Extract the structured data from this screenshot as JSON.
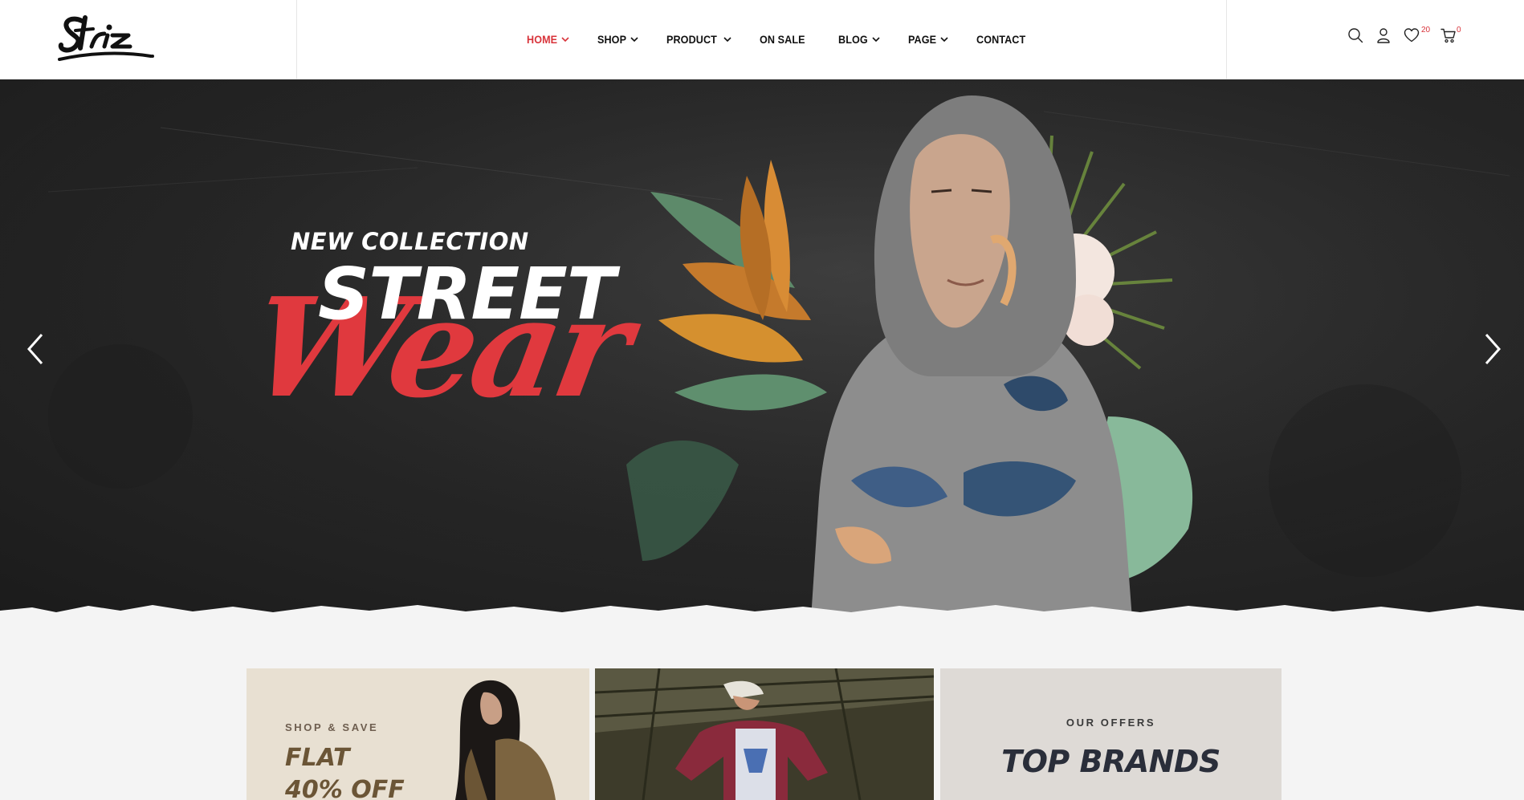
{
  "brand": {
    "logo_text": "Striz"
  },
  "nav": {
    "items": [
      {
        "label": "HOME",
        "has_dropdown": true,
        "active": true
      },
      {
        "label": "SHOP",
        "has_dropdown": true,
        "active": false
      },
      {
        "label": "PRODUCT",
        "has_dropdown": true,
        "active": false
      },
      {
        "label": "ON SALE",
        "has_dropdown": false,
        "active": false
      },
      {
        "label": "BLOG",
        "has_dropdown": true,
        "active": false
      },
      {
        "label": "PAGE",
        "has_dropdown": true,
        "active": false
      },
      {
        "label": "CONTACT",
        "has_dropdown": false,
        "active": false
      }
    ]
  },
  "header_icons": {
    "search": "search-icon",
    "account": "user-icon",
    "wishlist": {
      "icon": "heart-icon",
      "count": "20"
    },
    "cart": {
      "icon": "cart-icon",
      "count": "0"
    }
  },
  "hero": {
    "subtitle": "NEW COLLECTION",
    "title": "STREET",
    "script": "Wear",
    "prev": "chevron-left-icon",
    "next": "chevron-right-icon"
  },
  "banners": [
    {
      "eyebrow": "SHOP & SAVE",
      "line1": "FLAT",
      "line2": "40% OFF"
    },
    {
      "image": "skater-photo"
    },
    {
      "eyebrow": "OUR OFFERS",
      "title": "TOP BRANDS"
    }
  ],
  "colors": {
    "accent": "#d8333a",
    "hero_bg": "#262626",
    "text_dark": "#111111"
  }
}
